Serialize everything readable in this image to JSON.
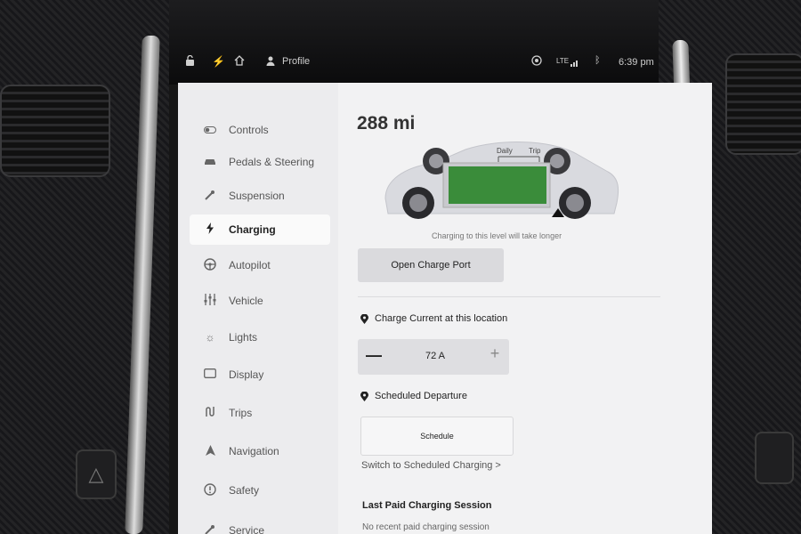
{
  "status_bar": {
    "profile_label": "Profile",
    "network": "LTE",
    "time": "6:39 pm"
  },
  "sidebar": {
    "items": [
      {
        "label": "Controls",
        "icon": "toggle-icon"
      },
      {
        "label": "Pedals & Steering",
        "icon": "car-icon"
      },
      {
        "label": "Suspension",
        "icon": "wrench-icon"
      },
      {
        "label": "Charging",
        "icon": "lightning-icon",
        "active": true
      },
      {
        "label": "Autopilot",
        "icon": "steering-wheel-icon"
      },
      {
        "label": "Vehicle",
        "icon": "sliders-icon"
      },
      {
        "label": "Lights",
        "icon": "sun-icon"
      },
      {
        "label": "Display",
        "icon": "display-icon"
      },
      {
        "label": "Trips",
        "icon": "trips-icon"
      },
      {
        "label": "Navigation",
        "icon": "navigation-arrow-icon"
      },
      {
        "label": "Safety",
        "icon": "alert-icon"
      },
      {
        "label": "Service",
        "icon": "wrench-icon"
      }
    ]
  },
  "charging": {
    "range": "288 mi",
    "daily_label": "Daily",
    "trip_label": "Trip",
    "level_note": "Charging to this level will take longer",
    "open_port_label": "Open Charge Port",
    "charge_current_label": "Charge Current at this location",
    "current_value": "72 A",
    "scheduled_departure_label": "Scheduled Departure",
    "schedule_button_label": "Schedule",
    "switch_link": "Switch to Scheduled Charging >",
    "last_paid_title": "Last Paid Charging Session",
    "no_recent": "No recent paid charging session"
  },
  "colors": {
    "screen_bg": "#f2f2f3",
    "battery_green": "#3a8c3a",
    "accent_dark": "#222222"
  }
}
